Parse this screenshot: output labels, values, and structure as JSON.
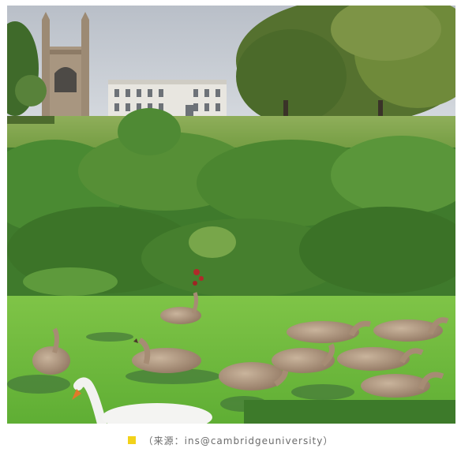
{
  "photo": {
    "subject": "Cambridge cygnets on the river"
  },
  "caption": {
    "text": "（来源：ins@cambridgeuniversity）",
    "marker_color": "#f2d21a"
  }
}
